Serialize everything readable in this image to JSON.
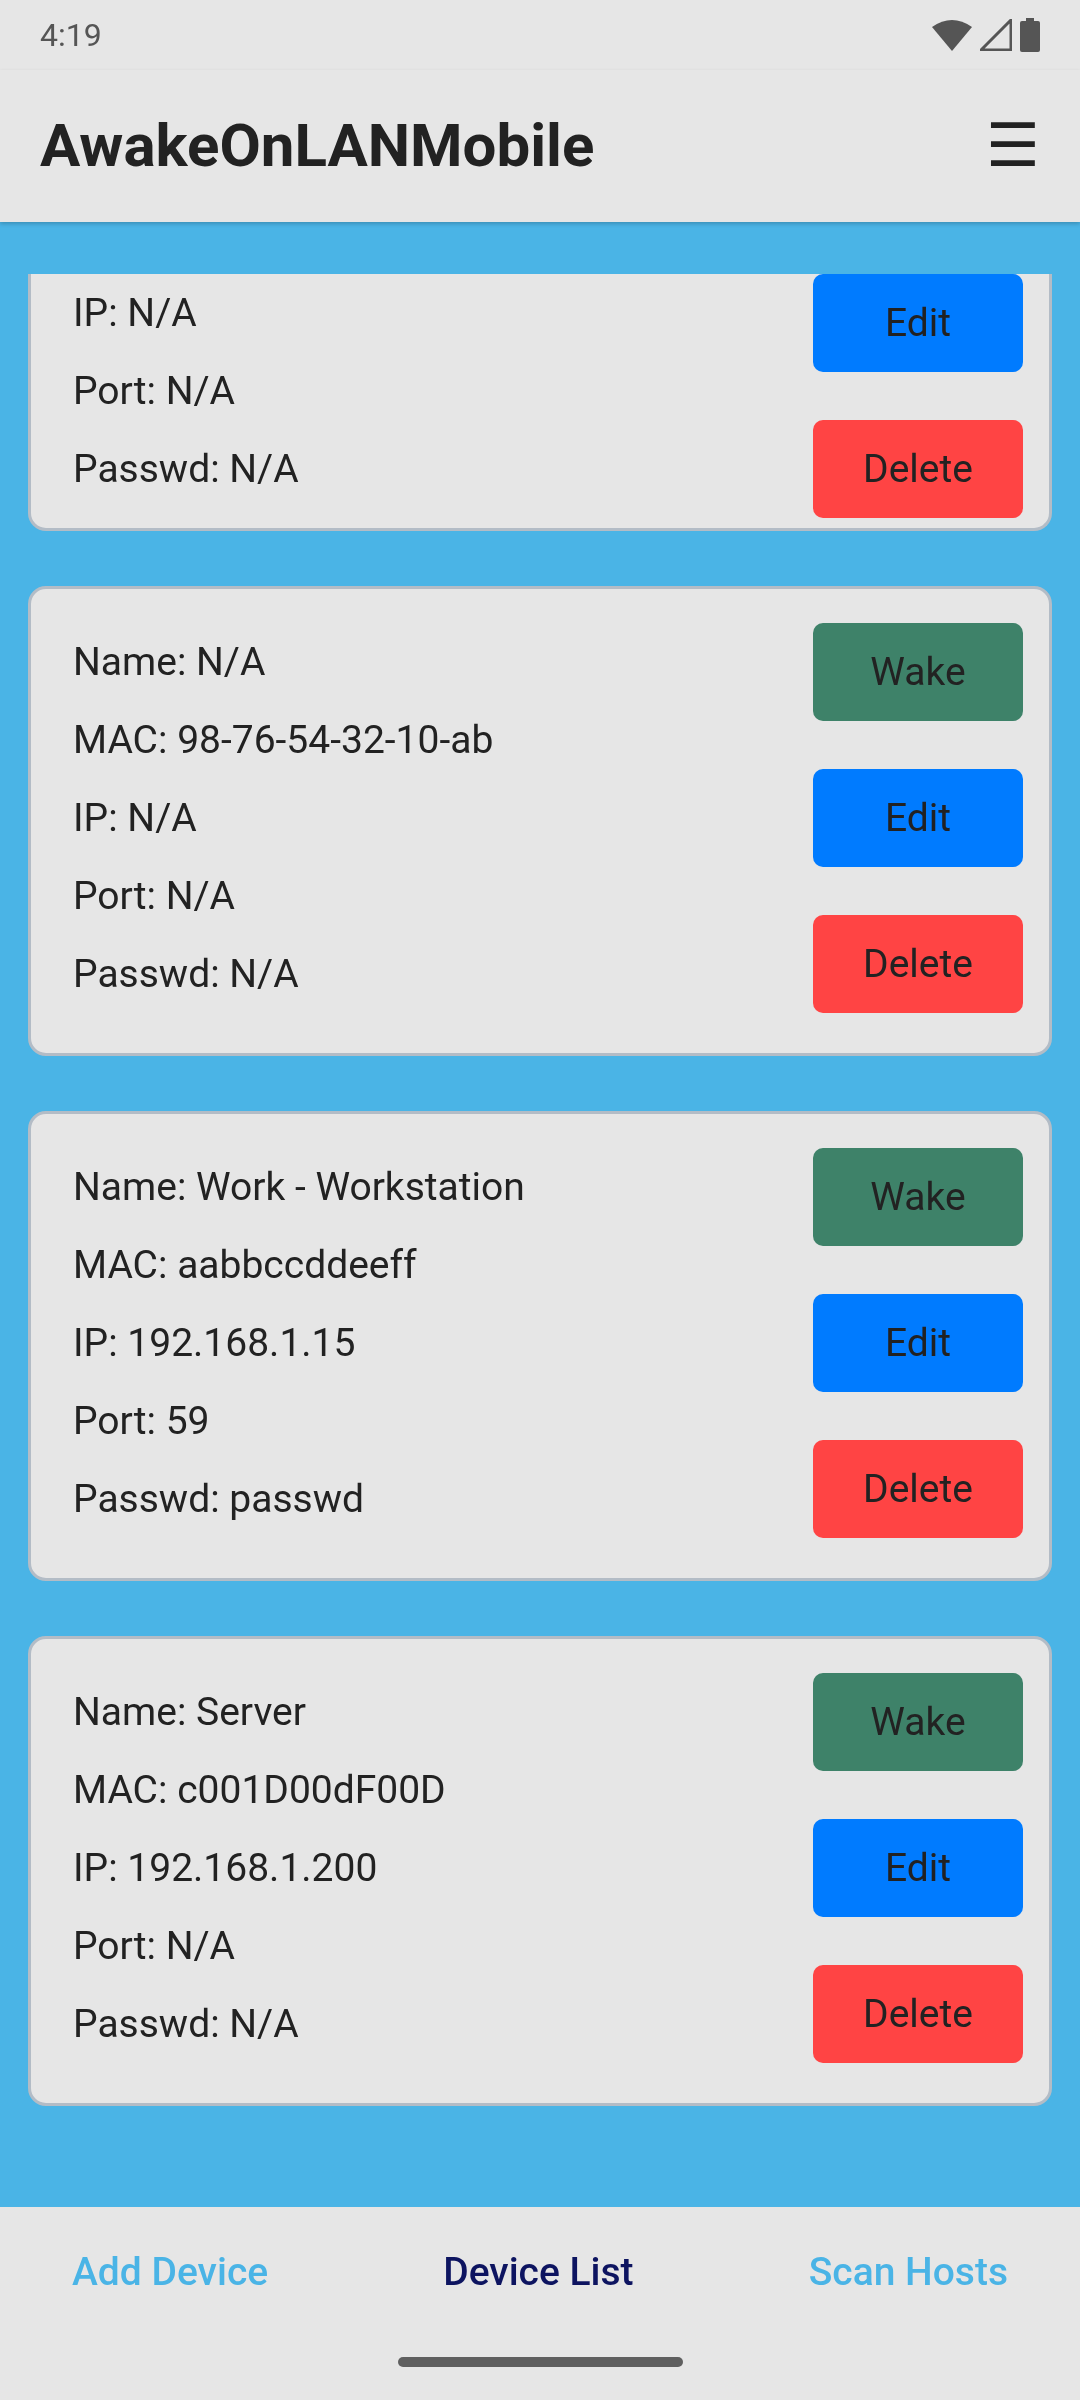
{
  "status_bar": {
    "time": "4:19"
  },
  "app_bar": {
    "title": "AwakeOnLANMobile",
    "menu_glyph": "☰"
  },
  "devices": [
    {
      "fields": [
        "IP: N/A",
        "Port: N/A",
        "Passwd: N/A"
      ],
      "buttons": [
        {
          "kind": "edit",
          "label": "Edit"
        },
        {
          "kind": "delete",
          "label": "Delete"
        }
      ],
      "partial": true
    },
    {
      "fields": [
        "Name: N/A",
        "MAC: 98-76-54-32-10-ab",
        "IP: N/A",
        "Port: N/A",
        "Passwd: N/A"
      ],
      "buttons": [
        {
          "kind": "wake",
          "label": "Wake"
        },
        {
          "kind": "edit",
          "label": "Edit"
        },
        {
          "kind": "delete",
          "label": "Delete"
        }
      ],
      "partial": false
    },
    {
      "fields": [
        "Name: Work - Workstation",
        "MAC: aabbccddeeff",
        "IP: 192.168.1.15",
        "Port: 59",
        "Passwd: passwd"
      ],
      "buttons": [
        {
          "kind": "wake",
          "label": "Wake"
        },
        {
          "kind": "edit",
          "label": "Edit"
        },
        {
          "kind": "delete",
          "label": "Delete"
        }
      ],
      "partial": false
    },
    {
      "fields": [
        "Name: Server",
        "MAC: c001D00dF00D",
        "IP: 192.168.1.200",
        "Port: N/A",
        "Passwd: N/A"
      ],
      "buttons": [
        {
          "kind": "wake",
          "label": "Wake"
        },
        {
          "kind": "edit",
          "label": "Edit"
        },
        {
          "kind": "delete",
          "label": "Delete"
        }
      ],
      "partial": false
    }
  ],
  "tabs": [
    {
      "label": "Add Device",
      "selected": false
    },
    {
      "label": "Device List",
      "selected": true
    },
    {
      "label": "Scan Hosts",
      "selected": false
    }
  ]
}
